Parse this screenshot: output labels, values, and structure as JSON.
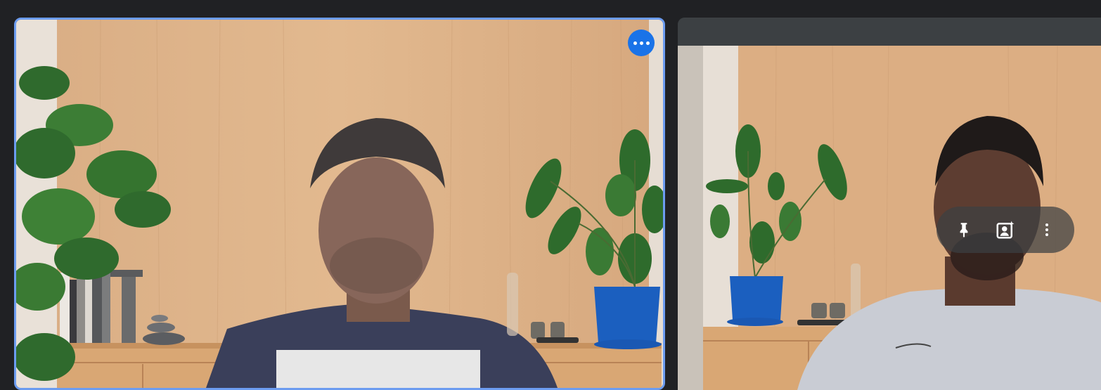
{
  "participants": [
    {
      "position": "left",
      "highlighted": true,
      "more_options_icon": "more-horizontal-icon",
      "border_color": "#6c9cf0",
      "button_color": "#1a73e8"
    },
    {
      "position": "right",
      "hover_controls": [
        "pin-icon",
        "visual-effects-icon",
        "more-vertical-icon"
      ]
    }
  ],
  "colors": {
    "background": "#202124",
    "tile_bar": "#3c4043"
  }
}
